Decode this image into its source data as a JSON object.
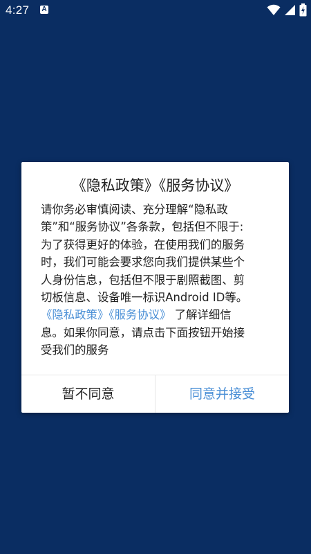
{
  "status_bar": {
    "time": "4:27",
    "app_icon_letter": "A",
    "icons": [
      "wifi-icon",
      "cell-signal-icon",
      "battery-charging-icon"
    ]
  },
  "dialog": {
    "title": "《隐私政策》《服务协议》",
    "body_lines": [
      "请你务必审慎阅读、充分理解“隐私政",
      "策”和“服务协议”各条款，包括但不限于:",
      "为了获得更好的体验，在使用我们的服务",
      "时，我们可能会要求您向我们提供某些个",
      "人身份信息，包括但不限于剧照截图、剪",
      "切板信息、设备唯一标识Android ID等。"
    ],
    "privacy_link": "《隐私政策》",
    "service_link": "《服务协议》",
    "after_links": " 了解详细信",
    "tail_lines": [
      "息。如果你同意，请点击下面按钮开始接",
      "受我们的服务"
    ],
    "decline_label": "暂不同意",
    "accept_label": "同意并接受"
  },
  "colors": {
    "background": "#0a2d62",
    "link": "#4a8fd6",
    "text": "#222222"
  }
}
